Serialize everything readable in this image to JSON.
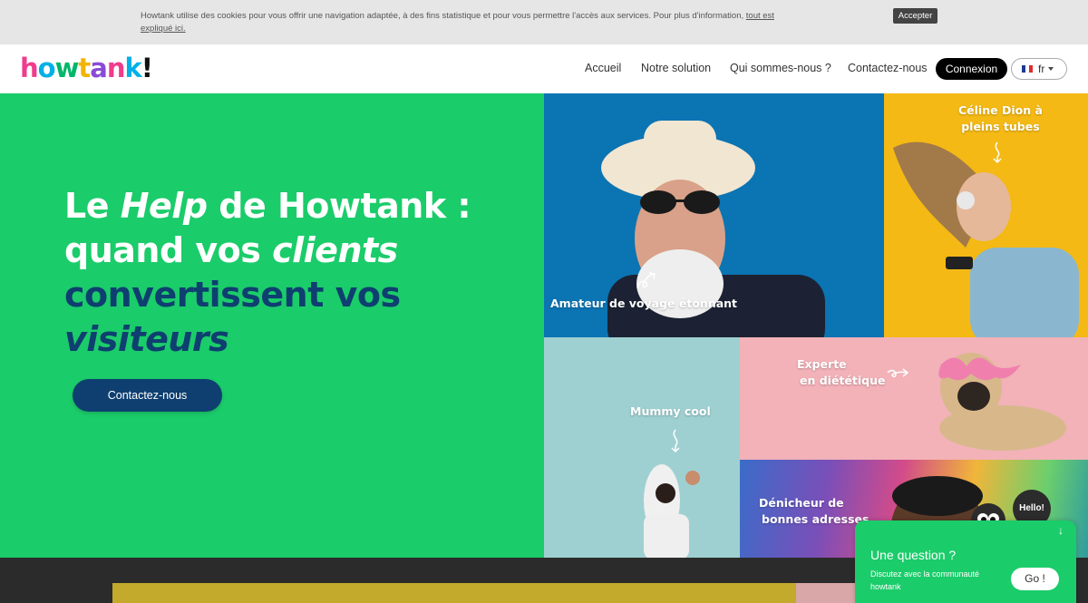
{
  "cookie": {
    "text": "Howtank utilise des cookies pour vous offrir une navigation adaptée, à des fins statistique et pour vous permettre l'accès aux services. Pour plus d'information,",
    "link": "tout est expliqué ici.",
    "accept": "Accepter"
  },
  "header": {
    "logo": [
      "h",
      "o",
      "w",
      "t",
      "a",
      "n",
      "k",
      "!"
    ],
    "logo_colors": [
      "#f03c8c",
      "#00b0e6",
      "#00b66a",
      "#f3b400",
      "#8a4cd6",
      "#f03c8c",
      "#00b0e6",
      "#111111"
    ],
    "nav": [
      "Accueil",
      "Notre solution",
      "Qui sommes-nous ?",
      "Contactez-nous"
    ],
    "login": "Connexion",
    "lang": "fr"
  },
  "hero": {
    "line1_a": "Le ",
    "line1_b": "Help",
    "line1_c": " de Howtank :",
    "line2_a": "quand vos ",
    "line2_b": "clients",
    "line3": "convertissent vos",
    "line4": "visiteurs",
    "cta": "Contactez-nous"
  },
  "tiles": {
    "t1": "Amateur de voyage étonnant",
    "t2_a": "Céline Dion à",
    "t2_b": "pleins tubes",
    "t3": "Mummy cool",
    "t4_a": "Experte",
    "t4_b": "en diététique",
    "t5_a": "Dénicheur de",
    "t5_b": "bonnes adresses"
  },
  "chat": {
    "bubble": "Hello!",
    "title": "Une question ?",
    "subtitle": "Discutez avec la communauté howtank",
    "go": "Go !"
  },
  "colors": {
    "hero_green": "#1bcc6a",
    "navy": "#0e3f70"
  }
}
